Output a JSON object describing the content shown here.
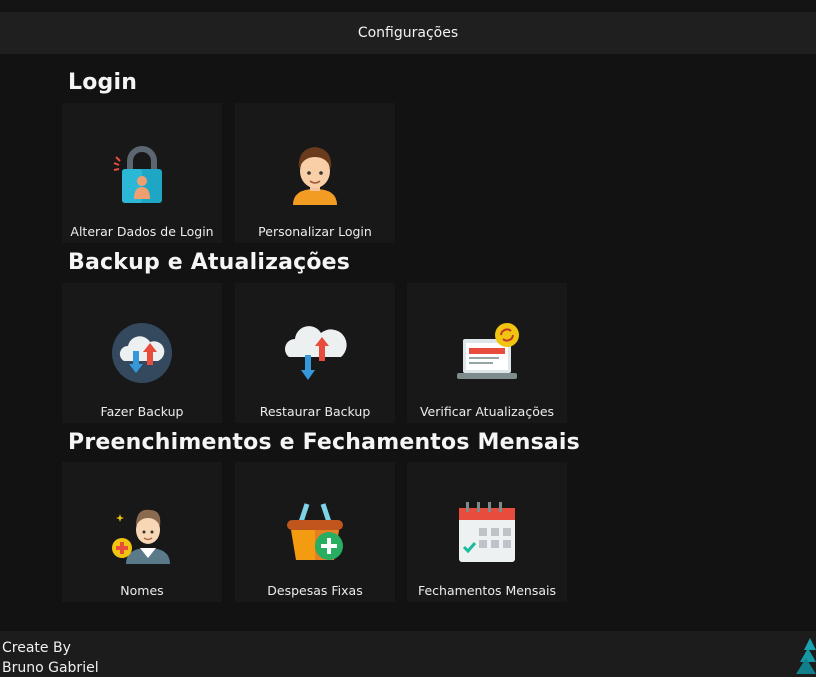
{
  "window": {
    "title": "Configurações"
  },
  "sections": [
    {
      "title": "Login",
      "tiles": [
        {
          "label": "Alterar Dados de Login",
          "icon": "padlock-user-icon"
        },
        {
          "label": "Personalizar Login",
          "icon": "user-avatar-icon"
        }
      ]
    },
    {
      "title": "Backup e Atualizações",
      "tiles": [
        {
          "label": "Fazer Backup",
          "icon": "cloud-upload-download-icon"
        },
        {
          "label": "Restaurar Backup",
          "icon": "cloud-sync-icon"
        },
        {
          "label": "Verificar Atualizações",
          "icon": "laptop-update-icon"
        }
      ]
    },
    {
      "title": "Preenchimentos e Fechamentos Mensais",
      "tiles": [
        {
          "label": "Nomes",
          "icon": "person-add-icon"
        },
        {
          "label": "Despesas Fixas",
          "icon": "basket-add-icon"
        },
        {
          "label": "Fechamentos Mensais",
          "icon": "calendar-check-icon"
        }
      ]
    }
  ],
  "footer": {
    "line1": "Create By",
    "line2": "Bruno Gabriel",
    "logo_icon": "tree-logo-icon"
  },
  "colors": {
    "background": "#121212",
    "tile": "#181818",
    "titlebar": "#1f1f1f",
    "footer": "#1c1c1c"
  }
}
